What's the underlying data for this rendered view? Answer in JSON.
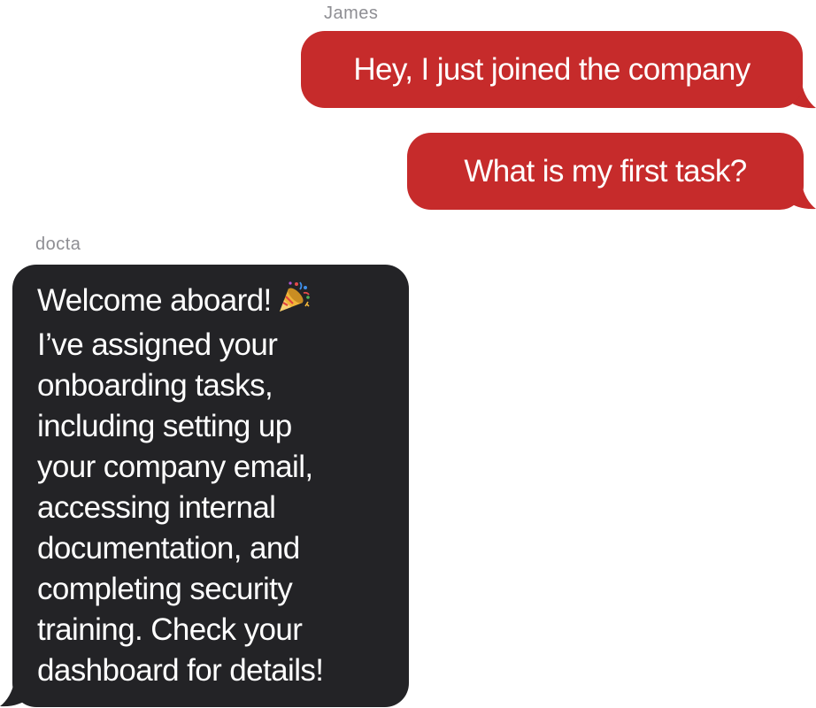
{
  "conversation": {
    "messages": [
      {
        "sender": "James",
        "direction": "outgoing",
        "text": "Hey, I just joined the company"
      },
      {
        "sender": "James",
        "direction": "outgoing",
        "text": "What is my first task?"
      },
      {
        "sender": "docta",
        "direction": "incoming",
        "lines": [
          "Welcome aboard!",
          "I’ve assigned your",
          "onboarding tasks,",
          "including setting up",
          "your company email,",
          "accessing internal",
          "documentation, and",
          "completing security",
          "training. Check your",
          "dashboard for details!"
        ],
        "emoji": "party-popper-icon"
      }
    ]
  },
  "colors": {
    "outgoing_bubble": "#c62b2b",
    "incoming_bubble": "#232326",
    "sender_label": "#8e8e93",
    "bubble_text": "#ffffff"
  }
}
